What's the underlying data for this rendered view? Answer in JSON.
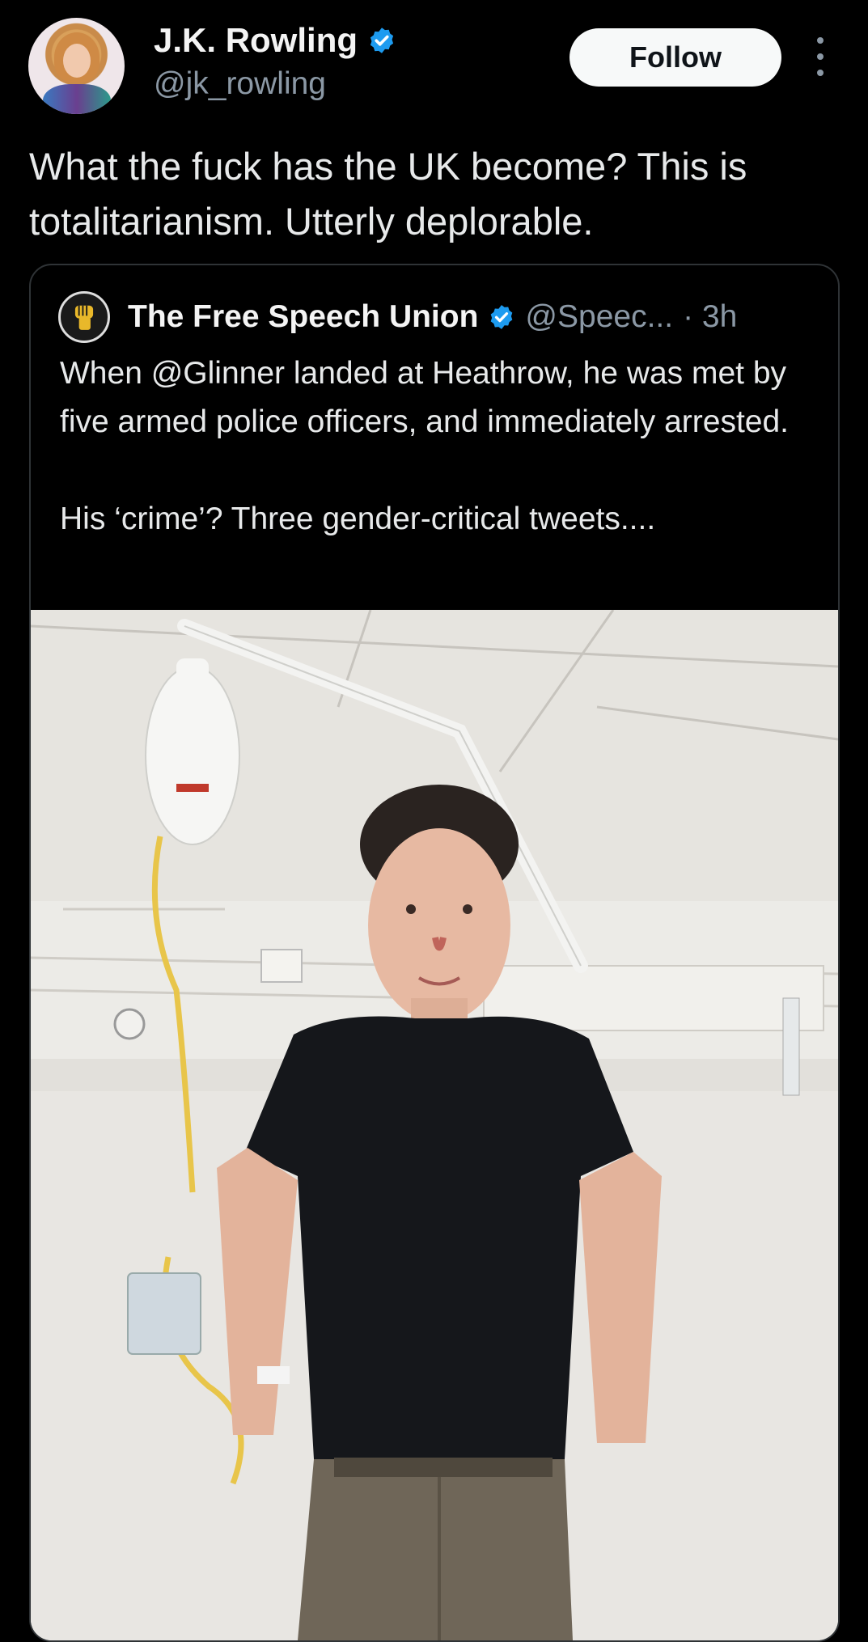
{
  "author": {
    "name": "J.K. Rowling",
    "handle": "@jk_rowling",
    "verified_icon": "verified-badge-icon",
    "follow_label": "Follow",
    "more_icon": "more-options-icon"
  },
  "tweet": {
    "text": "What the fuck has the UK become? This is totalitarianism. Utterly deplorable."
  },
  "quoted": {
    "name": "The Free Speech Union",
    "handle": "@Speec...",
    "time": "· 3h",
    "paragraph1": "When @Glinner landed at Heathrow, he was met by five armed police officers, and immediately arrested.",
    "paragraph2": "His ‘crime’? Three gender-critical tweets....",
    "logo_icon": "raised-fist-icon",
    "photo": "man-in-hospital-room-photo"
  },
  "colors": {
    "background": "#000000",
    "text": "#e7e9ea",
    "secondary": "#8b98a5",
    "verified": "#1d9bf0",
    "follow_bg": "#f7f9f9"
  }
}
